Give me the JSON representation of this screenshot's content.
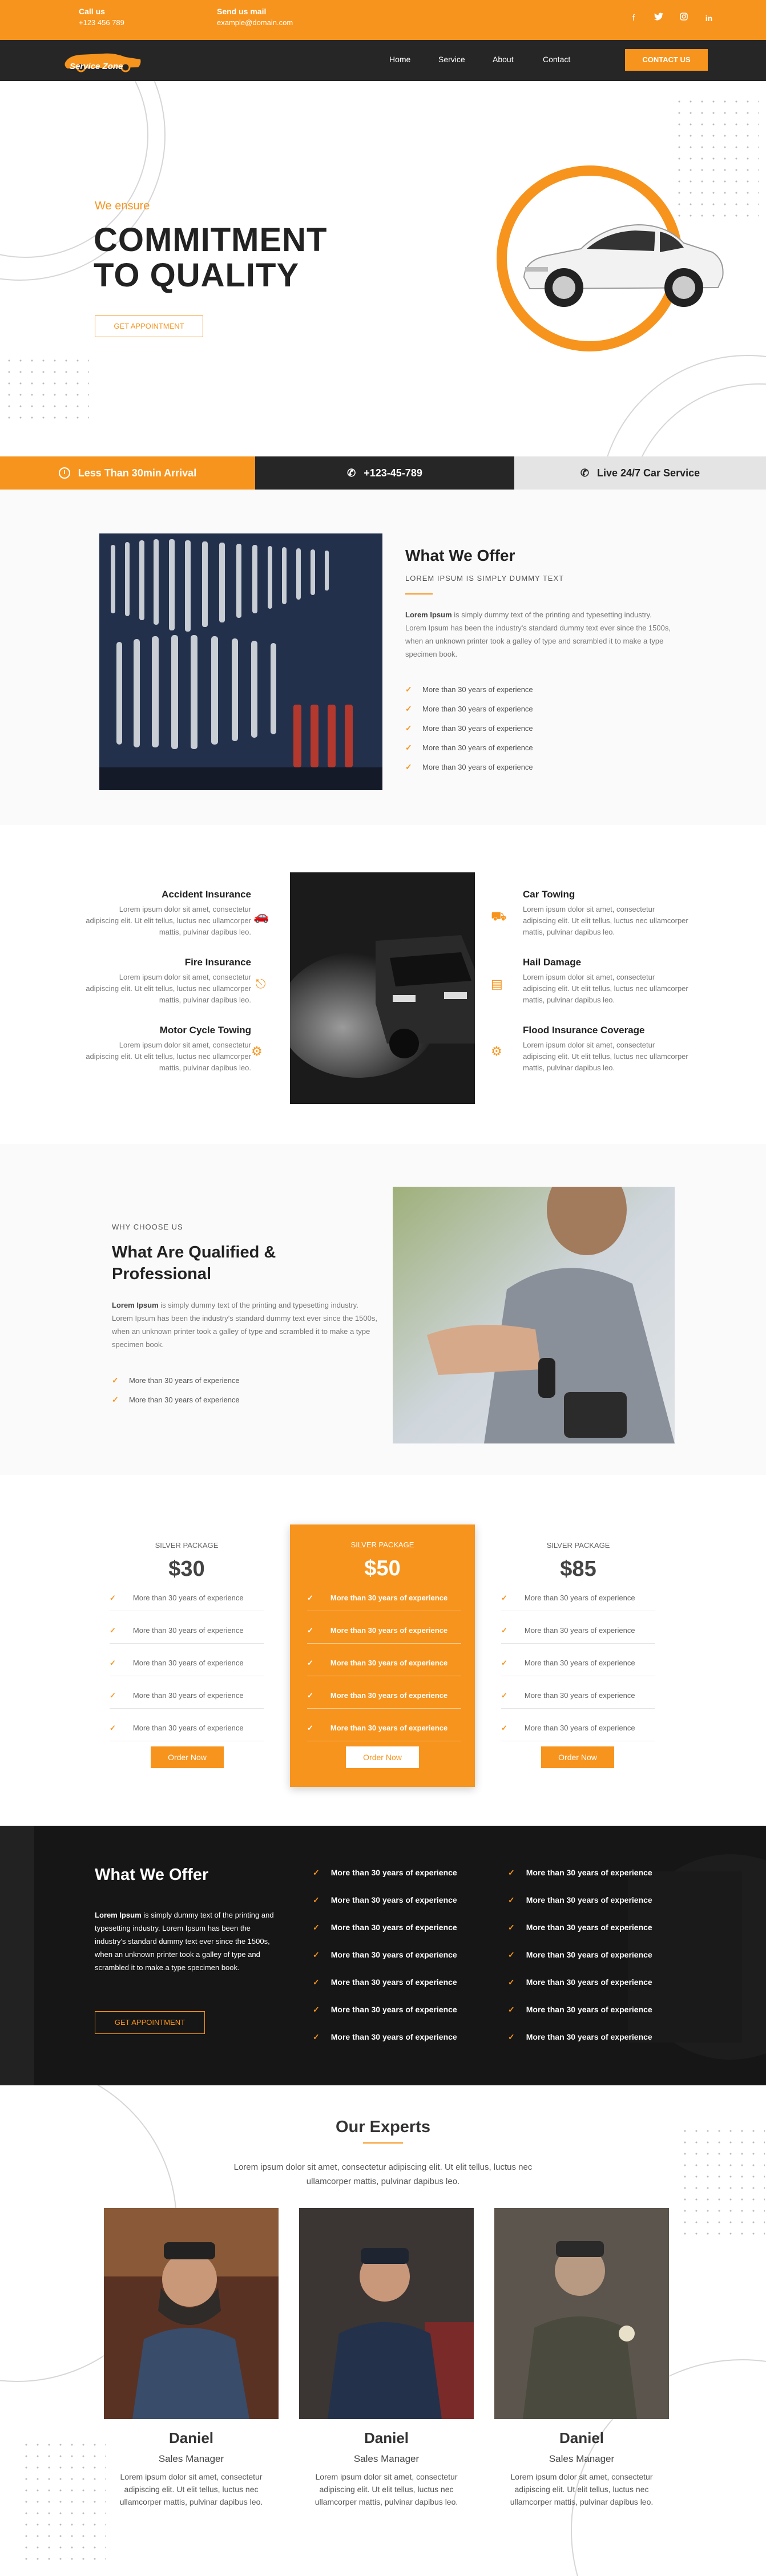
{
  "topbar": {
    "call_label": "Call us",
    "call_value": "+123 456 789",
    "mail_label": "Send us mail",
    "mail_value": "example@domain.com",
    "social": [
      "f",
      "t",
      "ig",
      "in"
    ]
  },
  "nav": {
    "logo_text": "Service Zone",
    "links": [
      "Home",
      "Service",
      "About",
      "Contact"
    ],
    "cta": "CONTACT US"
  },
  "hero": {
    "kicker": "We ensure",
    "title_line1": "COMMITMENT",
    "title_line2": "TO QUALITY",
    "button": "GET APPOINTMENT"
  },
  "strip": {
    "item1": "Less Than 30min Arrival",
    "item2": "+123-45-789",
    "item3": "Live 24/7 Car Service"
  },
  "offer": {
    "title": "What We Offer",
    "subtitle": "LOREM IPSUM IS SIMPLY DUMMY TEXT",
    "body_bold": "Lorem Ipsum",
    "body": " is simply dummy text of the printing and typesetting industry. Lorem Ipsum has been the industry's standard dummy text ever since the 1500s, when an unknown printer took a galley of type and scrambled it to make a type specimen book.",
    "features": [
      "More than 30 years of experience",
      "More than 30 years of experience",
      "More than 30 years of experience",
      "More than 30 years of experience",
      "More than 30 years of experience"
    ]
  },
  "services": {
    "left": [
      {
        "title": "Accident Insurance",
        "text": "Lorem ipsum dolor sit amet, consectetur adipiscing elit. Ut elit tellus, luctus nec ullamcorper mattis, pulvinar dapibus leo.",
        "icon": "car-crash-icon"
      },
      {
        "title": "Fire Insurance",
        "text": "Lorem ipsum dolor sit amet, consectetur adipiscing elit. Ut elit tellus, luctus nec ullamcorper mattis, pulvinar dapibus leo.",
        "icon": "fire-extinguisher-icon"
      },
      {
        "title": "Motor Cycle Towing",
        "text": "Lorem ipsum dolor sit amet, consectetur adipiscing elit. Ut elit tellus, luctus nec ullamcorper mattis, pulvinar dapibus leo.",
        "icon": "motorcycle-icon"
      }
    ],
    "right": [
      {
        "title": "Car Towing",
        "text": "Lorem ipsum dolor sit amet, consectetur adipiscing elit. Ut elit tellus, luctus nec ullamcorper mattis, pulvinar dapibus leo.",
        "icon": "tow-truck-icon"
      },
      {
        "title": "Hail Damage",
        "text": "Lorem ipsum dolor sit amet, consectetur adipiscing elit. Ut elit tellus, luctus nec ullamcorper mattis, pulvinar dapibus leo.",
        "icon": "chart-icon"
      },
      {
        "title": "Flood Insurance Coverage",
        "text": "Lorem ipsum dolor sit amet, consectetur adipiscing elit. Ut elit tellus, luctus nec ullamcorper mattis, pulvinar dapibus leo.",
        "icon": "gear-icon"
      }
    ]
  },
  "why": {
    "kicker": "WHY CHOOSE US",
    "title_line1": "What Are Qualified &",
    "title_line2": "Professional",
    "body_bold": "Lorem Ipsum",
    "body": " is simply dummy text of the printing and typesetting industry. Lorem Ipsum has been the industry's standard dummy text ever since the 1500s, when an unknown printer took a galley of type and scrambled it to make a type specimen book.",
    "features": [
      "More than 30 years of experience",
      "More than 30 years of experience"
    ]
  },
  "pricing": [
    {
      "name": "SILVER PACKAGE",
      "price": "$30",
      "button": "Order Now"
    },
    {
      "name": "SILVER PACKAGE",
      "price": "$50",
      "button": "Order Now"
    },
    {
      "name": "SILVER PACKAGE",
      "price": "$85",
      "button": "Order Now"
    }
  ],
  "pricing_feature": "More than 30 years of experience",
  "dark": {
    "title": "What We Offer",
    "body_bold": "Lorem Ipsum",
    "body": " is simply dummy text of the printing and typesetting industry. Lorem Ipsum has been the industry's standard dummy text ever since the 1500s, when an unknown printer took a galley of type and scrambled it to make a type specimen book.",
    "button": "GET APPOINTMENT",
    "feature": "More than 30 years of experience"
  },
  "experts": {
    "title": "Our Experts",
    "intro_line1": "Lorem ipsum dolor sit amet, consectetur adipiscing elit. Ut elit tellus, luctus nec",
    "intro_line2": "ullamcorper mattis, pulvinar dapibus leo.",
    "people": [
      {
        "name": "Daniel",
        "role": "Sales Manager",
        "text": "Lorem ipsum dolor sit amet, consectetur adipiscing elit. Ut elit tellus, luctus nec ullamcorper mattis, pulvinar dapibus leo."
      },
      {
        "name": "Daniel",
        "role": "Sales Manager",
        "text": "Lorem ipsum dolor sit amet, consectetur adipiscing elit. Ut elit tellus, luctus nec ullamcorper mattis, pulvinar dapibus leo."
      },
      {
        "name": "Daniel",
        "role": "Sales Manager",
        "text": "Lorem ipsum dolor sit amet, consectetur adipiscing elit. Ut elit tellus, luctus nec ullamcorper mattis, pulvinar dapibus leo."
      }
    ]
  },
  "colors": {
    "accent": "#f7941d",
    "dark": "#262626"
  }
}
